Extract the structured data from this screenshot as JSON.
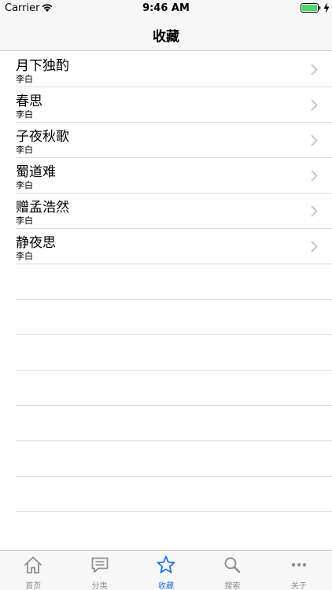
{
  "status_bar": {
    "carrier": "Carrier",
    "time": "9:46 AM",
    "battery_color": "#4cd964"
  },
  "nav": {
    "title": "收藏"
  },
  "list": {
    "items": [
      {
        "title": "月下独酌",
        "subtitle": "李白"
      },
      {
        "title": "春思",
        "subtitle": "李白"
      },
      {
        "title": "子夜秋歌",
        "subtitle": "李白"
      },
      {
        "title": "蜀道难",
        "subtitle": "李白"
      },
      {
        "title": "赠孟浩然",
        "subtitle": "李白"
      },
      {
        "title": "静夜思",
        "subtitle": "李白"
      }
    ]
  },
  "tabs": [
    {
      "label": "首页",
      "icon": "home-icon"
    },
    {
      "label": "分类",
      "icon": "chat-bubble-icon"
    },
    {
      "label": "收藏",
      "icon": "star-icon",
      "active": true
    },
    {
      "label": "搜索",
      "icon": "magnifier-icon"
    },
    {
      "label": "关于",
      "icon": "more-dots-icon"
    }
  ],
  "colors": {
    "accent": "#1a73e8",
    "tab_inactive": "#8e8e93",
    "chevron": "#c7c7cc"
  }
}
